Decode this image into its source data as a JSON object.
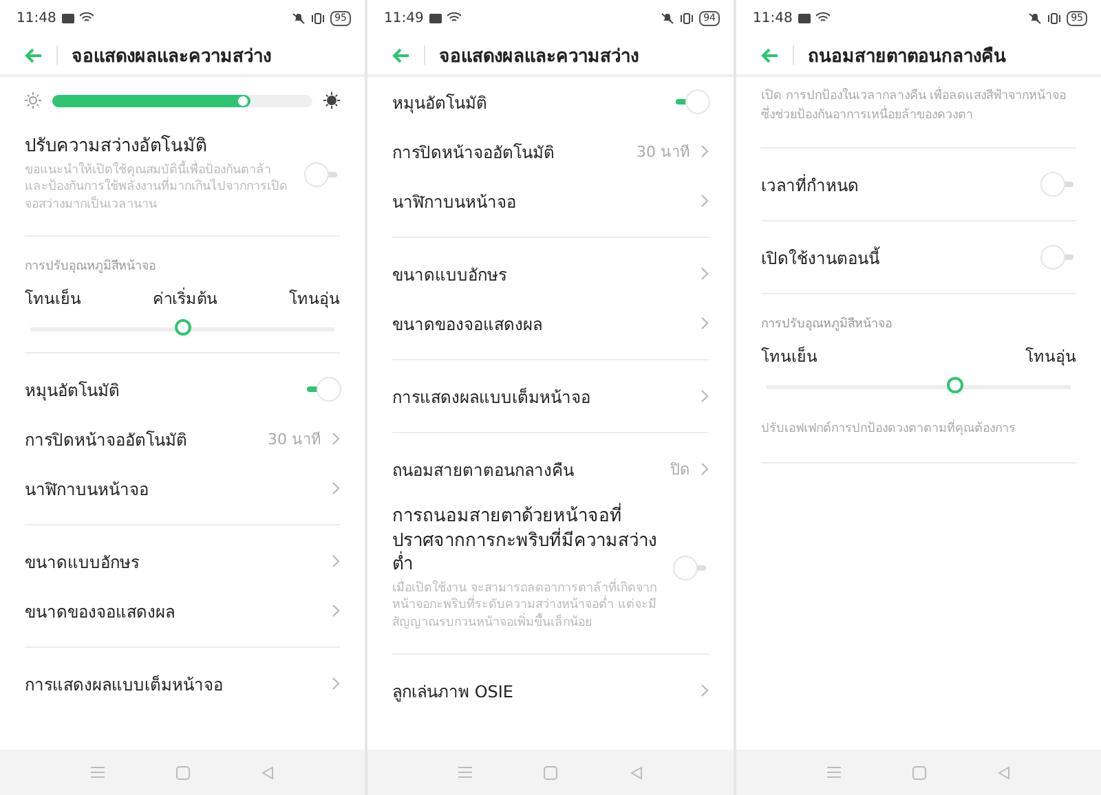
{
  "screens": [
    {
      "status": {
        "time": "11:48",
        "battery": "95"
      },
      "title": "จอแสดงผลและความสว่าง",
      "items": [
        {
          "kind": "brightness",
          "level": 0.76
        },
        {
          "kind": "toggle",
          "label": "ปรับความสว่างอัตโนมัติ",
          "description": "ขอแนะนำให้เปิดใช้คุณสมบัตินี้เพื่อป้องกันตาล้าและป้องกันการใช้พลังงานที่มากเกินไปจากการเปิดจอสว่างมากเป็นเวลานาน",
          "on": false
        },
        {
          "kind": "divider"
        },
        {
          "kind": "caption",
          "text": "การปรับอุณหภูมิสีหน้าจอ"
        },
        {
          "kind": "tone",
          "labels": [
            "โทนเย็น",
            "ค่าเริ่มต้น",
            "โทนอุ่น"
          ],
          "level": 0.5
        },
        {
          "kind": "divider"
        },
        {
          "kind": "toggle",
          "label": "หมุนอัตโนมัติ",
          "on": true
        },
        {
          "kind": "link",
          "label": "การปิดหน้าจออัตโนมัติ",
          "value": "30 นาที"
        },
        {
          "kind": "link",
          "label": "นาฬิกาบนหน้าจอ"
        },
        {
          "kind": "divider"
        },
        {
          "kind": "link",
          "label": "ขนาดแบบอักษร"
        },
        {
          "kind": "link",
          "label": "ขนาดของจอแสดงผล"
        },
        {
          "kind": "divider"
        },
        {
          "kind": "link",
          "label": "การแสดงผลแบบเต็มหน้าจอ"
        }
      ]
    },
    {
      "status": {
        "time": "11:49",
        "battery": "94"
      },
      "title": "จอแสดงผลและความสว่าง",
      "items": [
        {
          "kind": "toggle",
          "label": "หมุนอัตโนมัติ",
          "on": true
        },
        {
          "kind": "link",
          "label": "การปิดหน้าจออัตโนมัติ",
          "value": "30 นาที"
        },
        {
          "kind": "link",
          "label": "นาฬิกาบนหน้าจอ"
        },
        {
          "kind": "divider"
        },
        {
          "kind": "link",
          "label": "ขนาดแบบอักษร"
        },
        {
          "kind": "link",
          "label": "ขนาดของจอแสดงผล"
        },
        {
          "kind": "divider"
        },
        {
          "kind": "link",
          "label": "การแสดงผลแบบเต็มหน้าจอ"
        },
        {
          "kind": "divider"
        },
        {
          "kind": "link",
          "label": "ถนอมสายตาตอนกลางคืน",
          "value": "ปิด"
        },
        {
          "kind": "toggle",
          "label": "การถนอมสายตาด้วยหน้าจอที่ปราศจากการกะพริบที่มีความสว่างต่ำ",
          "description": "เมื่อเปิดใช้งาน จะสามารถลดอาการตาล้าที่เกิดจากหน้าจอกะพริบที่ระดับความสว่างหน้าจอต่ำ แต่จะมีสัญญาณรบกวนหน้าจอเพิ่มขึ้นเล็กน้อย",
          "on": false
        },
        {
          "kind": "divider"
        },
        {
          "kind": "link",
          "label": "ลูกเล่นภาพ OSIE"
        }
      ]
    },
    {
      "status": {
        "time": "11:48",
        "battery": "95"
      },
      "title": "ถนอมสายตาตอนกลางคืน",
      "items": [
        {
          "kind": "note",
          "text": "เปิด การปกป้องในเวลากลางคืน เพื่อลดแสงสีฟ้าจากหน้าจอ ซึ่งช่วยป้องกันอาการเหนื่อยล้าของดวงตา"
        },
        {
          "kind": "divider"
        },
        {
          "kind": "toggle",
          "label": "เวลาที่กำหนด",
          "on": false
        },
        {
          "kind": "divider"
        },
        {
          "kind": "toggle",
          "label": "เปิดใช้งานตอนนี้",
          "on": false
        },
        {
          "kind": "divider"
        },
        {
          "kind": "caption",
          "text": "การปรับอุณหภูมิสีหน้าจอ"
        },
        {
          "kind": "tone",
          "labels": [
            "โทนเย็น",
            "โทนอุ่น"
          ],
          "level": 0.62
        },
        {
          "kind": "note",
          "text": "ปรับเอฟเฟกต์การปกป้องดวงตาตามที่คุณต้องการ"
        },
        {
          "kind": "divider"
        }
      ]
    }
  ]
}
